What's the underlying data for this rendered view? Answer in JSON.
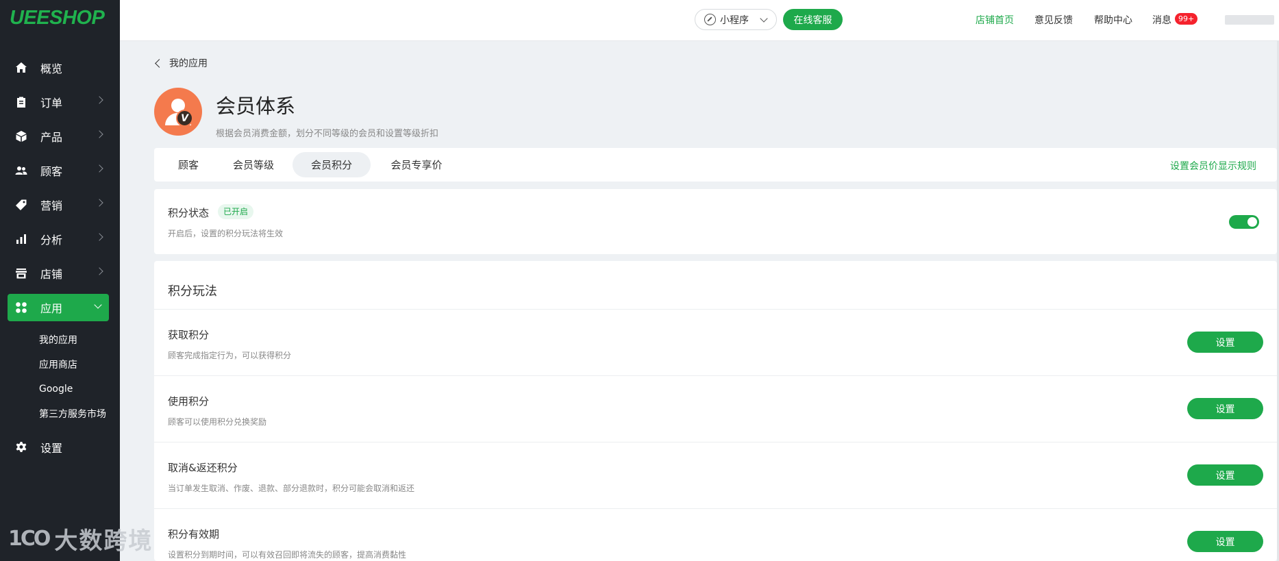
{
  "brand": {
    "logo": "UEESHOP",
    "accent": "#1ea94b"
  },
  "sidebar": {
    "items": [
      {
        "label": "概览",
        "icon": "home-icon",
        "has_chevron": false
      },
      {
        "label": "订单",
        "icon": "clipboard-icon",
        "has_chevron": true
      },
      {
        "label": "产品",
        "icon": "box-icon",
        "has_chevron": true
      },
      {
        "label": "顾客",
        "icon": "users-icon",
        "has_chevron": true
      },
      {
        "label": "营销",
        "icon": "tag-icon",
        "has_chevron": true
      },
      {
        "label": "分析",
        "icon": "bar-chart-icon",
        "has_chevron": true
      },
      {
        "label": "店铺",
        "icon": "store-icon",
        "has_chevron": true
      },
      {
        "label": "应用",
        "icon": "apps-grid-icon",
        "has_chevron": true,
        "active": true
      }
    ],
    "sub_items": [
      "我的应用",
      "应用商店",
      "Google",
      "第三方服务市场"
    ],
    "settings": {
      "label": "设置",
      "icon": "gear-icon"
    },
    "watermark": {
      "mark": "1CO",
      "text": "大数跨境"
    }
  },
  "topbar": {
    "mini_program": "小程序",
    "online_service": "在线客服",
    "store_home": "店铺首页",
    "feedback": "意见反馈",
    "help_center": "帮助中心",
    "messages": "消息",
    "messages_badge": "99+"
  },
  "header": {
    "back_label": "我的应用",
    "app_title": "会员体系",
    "app_desc": "根据会员消费金额，划分不同等级的会员和设置等级折扣",
    "icon_badge": "V"
  },
  "tabs": {
    "items": [
      "顾客",
      "会员等级",
      "会员积分",
      "会员专享价"
    ],
    "active_index": 2,
    "right_link": "设置会员价显示规则"
  },
  "status": {
    "title": "积分状态",
    "badge": "已开启",
    "desc": "开启后，设置的积分玩法将生效",
    "enabled": true
  },
  "rules": {
    "title": "积分玩法",
    "rows": [
      {
        "name": "获取积分",
        "desc": "顾客完成指定行为，可以获得积分",
        "button": "设置"
      },
      {
        "name": "使用积分",
        "desc": "顾客可以使用积分兑换奖励",
        "button": "设置"
      },
      {
        "name": "取消&返还积分",
        "desc": "当订单发生取消、作废、退款、部分退款时，积分可能会取消和返还",
        "button": "设置"
      },
      {
        "name": "积分有效期",
        "desc": "设置积分到期时间，可以有效召回即将流失的顾客，提高消费黏性",
        "button": "设置"
      }
    ]
  }
}
